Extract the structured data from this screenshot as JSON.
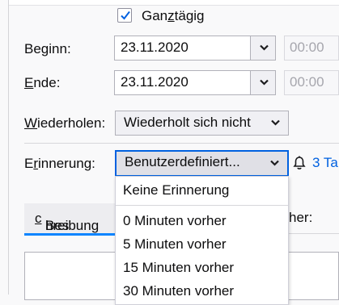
{
  "allday": {
    "label_pre": "Gan",
    "label_key": "z",
    "label_post": "tägig",
    "checked": true
  },
  "start": {
    "label_pre": "Be",
    "label_key": "g",
    "label_post": "inn:",
    "date": "23.11.2020",
    "time": "00:00"
  },
  "end": {
    "label_pre": "",
    "label_key": "E",
    "label_post": "nde:",
    "date": "23.11.2020",
    "time": "00:00"
  },
  "repeat": {
    "label_pre": "",
    "label_key": "W",
    "label_post": "iederholen:",
    "value": "Wiederholt sich nicht"
  },
  "reminder": {
    "label_pre": "E",
    "label_key": "r",
    "label_post": "innerung:",
    "value": "Benutzerdefiniert...",
    "count_text": "3 Ta",
    "options": [
      "Keine Erinnerung",
      "0 Minuten vorher",
      "5 Minuten vorher",
      "15 Minuten vorher",
      "30 Minuten vorher"
    ]
  },
  "tabs": {
    "description_pre": "Bes",
    "description_key": "c",
    "description_post": "hreibung",
    "right_label": "her:"
  },
  "colors": {
    "accent": "#0a84ff",
    "focus": "#0061e0",
    "link": "#0061e0"
  }
}
